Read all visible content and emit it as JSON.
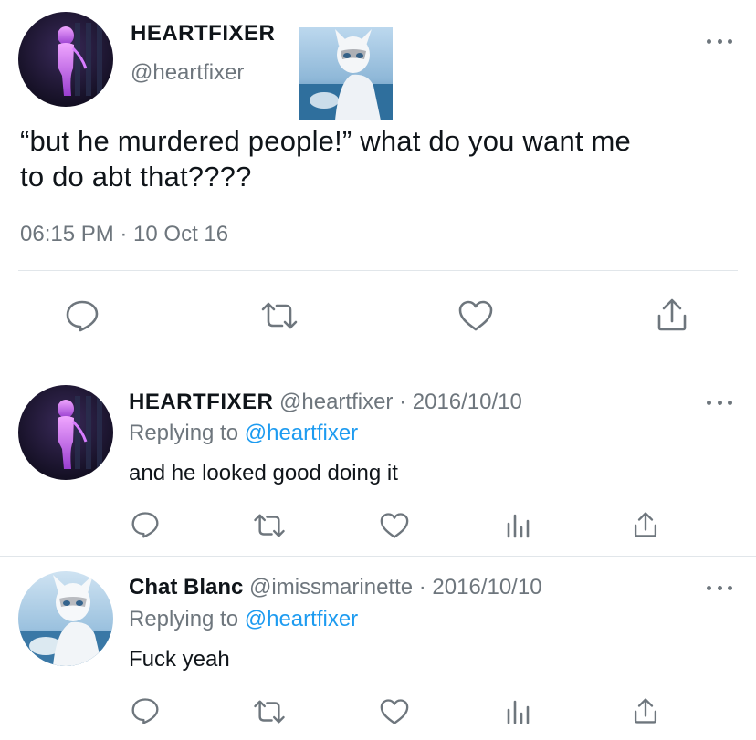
{
  "main_tweet": {
    "display_name": "HEARTFIXER",
    "handle": "@heartfixer",
    "text_line1": "“but he murdered people!” what do you want me",
    "text_line2": "to do abt that????",
    "timestamp": "06:15 PM · 10 Oct 16"
  },
  "replies": [
    {
      "display_name": "HEARTFIXER",
      "handle": "@heartfixer",
      "date": "· 2016/10/10",
      "replying_label": "Replying to",
      "replying_to": "@heartfixer",
      "text": "and he looked good doing it"
    },
    {
      "display_name": "Chat Blanc",
      "handle": "@imissmarinette",
      "date": "· 2016/10/10",
      "replying_label": "Replying to",
      "replying_to": "@heartfixer",
      "text": "Fuck yeah"
    }
  ],
  "icons": {
    "more": "more-horizontal-icon",
    "reply": "reply-bubble-icon",
    "retweet": "retweet-icon",
    "like": "heart-icon",
    "share": "share-upload-icon",
    "analytics": "analytics-bars-icon"
  },
  "colors": {
    "text": "#0f1419",
    "secondary": "#6e767d",
    "link": "#1d9bf0",
    "divider": "#e1e6ea"
  }
}
